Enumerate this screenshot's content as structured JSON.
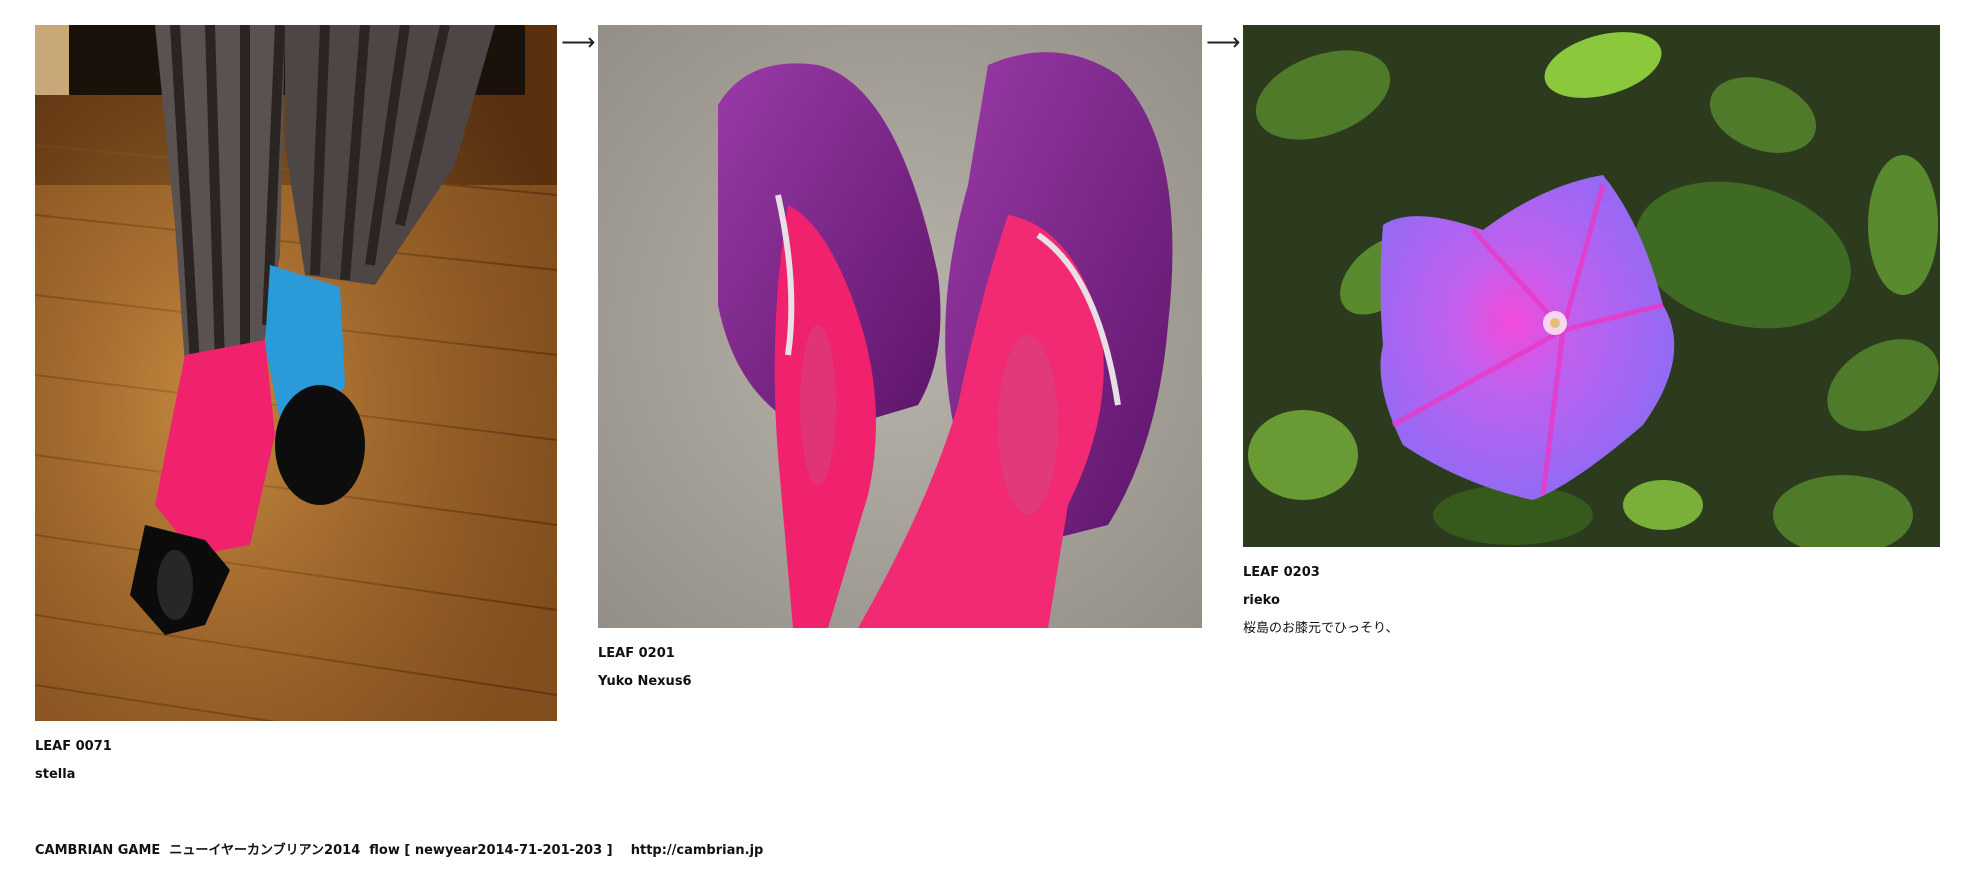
{
  "leaves": [
    {
      "id": "LEAF 0071",
      "author": "stella",
      "comment": "",
      "photo_icon": "photo-legs-pink-blue-socks"
    },
    {
      "id": "LEAF 0201",
      "author": "Yuko Nexus6",
      "comment": "",
      "photo_icon": "photo-purple-slippers-pink-tights"
    },
    {
      "id": "LEAF 0203",
      "author": "rieko",
      "comment": "桜島のお膝元でひっそり、",
      "photo_icon": "photo-morning-glory-flower"
    }
  ],
  "arrow_glyph": "⟶",
  "footer": {
    "text": "CAMBRIAN GAME  ニューイヤーカンブリアン2014  flow [ newyear2014-71-201-203 ]    http://cambrian.jp"
  },
  "colors": {
    "pink": "#f0226e",
    "blue": "#2a9ad8",
    "purple": "#7a1e86",
    "flower": "#b46cf0",
    "floor": "#b97a2e"
  }
}
